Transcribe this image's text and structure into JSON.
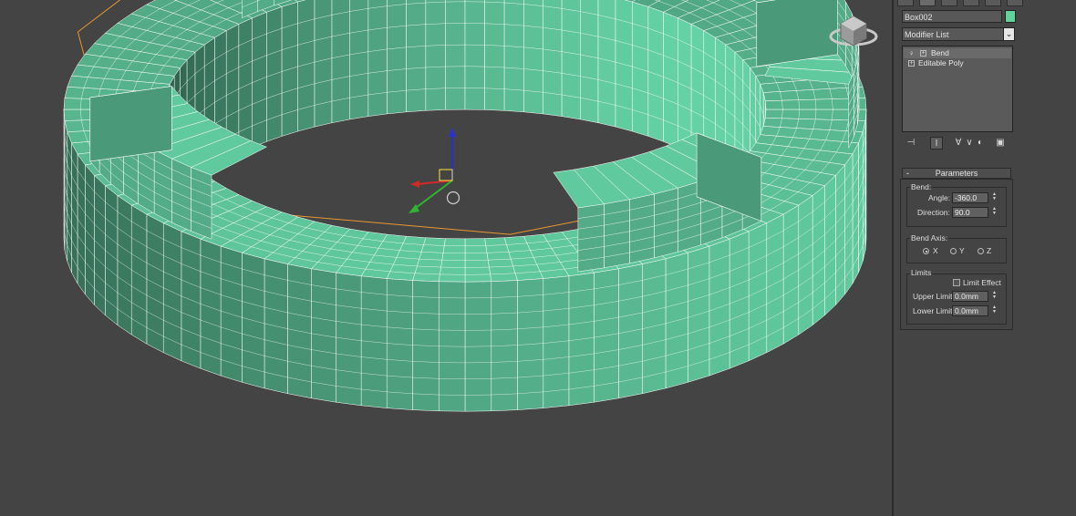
{
  "viewport": {
    "mesh_color": "#5cbf96",
    "wire_color": "#ffffff",
    "bbox_color": "#e8982f",
    "axis_x_color": "#d12a2a",
    "axis_y_color": "#2fb52f",
    "axis_z_color": "#2a2fd6",
    "viewcube": "viewcube-icon"
  },
  "panel": {
    "object_name": "Box002",
    "object_color": "#5fd49a",
    "modifier_list_label": "Modifier List",
    "stack": [
      {
        "label": "Bend",
        "icon": "lightbulb-icon"
      },
      {
        "label": "Editable Poly",
        "icon": "expand-icon"
      }
    ],
    "rollout_title": "Parameters",
    "bend_group": "Bend:",
    "angle_label": "Angle:",
    "angle_value": "-360.0",
    "direction_label": "Direction:",
    "direction_value": "90.0",
    "axis_group": "Bend Axis:",
    "axis_options": [
      "X",
      "Y",
      "Z"
    ],
    "axis_selected": "X",
    "limits_group": "Limits",
    "limit_effect_label": "Limit Effect",
    "upper_label": "Upper Limit:",
    "upper_value": "0.0mm",
    "lower_label": "Lower Limit:",
    "lower_value": "0.0mm"
  }
}
